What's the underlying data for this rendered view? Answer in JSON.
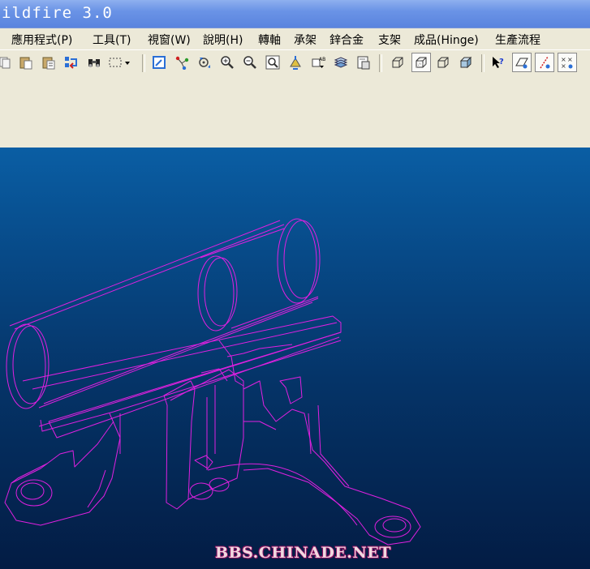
{
  "window": {
    "title": "ildfire 3.0"
  },
  "menu": {
    "items": [
      {
        "label": "應用程式(P)"
      },
      {
        "label": "工具(T)"
      },
      {
        "label": "視窗(W)"
      },
      {
        "label": "說明(H)"
      },
      {
        "label": "轉軸"
      },
      {
        "label": "承架"
      },
      {
        "label": "鋅合金"
      },
      {
        "label": "支架"
      },
      {
        "label": "成品(Hinge)"
      },
      {
        "label": "生產流程"
      }
    ]
  },
  "toolbar": {
    "buttons": [
      "copy-icon",
      "paste-icon",
      "paste-special-icon",
      "regenerate-icon",
      "find-icon",
      "select-box-icon",
      "repaint-icon",
      "spin-center-icon",
      "orient-mode-icon",
      "zoom-in-icon",
      "zoom-out-icon",
      "refit-icon",
      "reorient-icon",
      "saved-views-icon",
      "layers-icon",
      "model-setup-icon",
      "wireframe-icon",
      "hidden-line-icon",
      "no-hidden-icon",
      "shading-icon",
      "context-help-icon",
      "datum-planes-icon",
      "datum-axes-icon",
      "datum-points-icon"
    ],
    "pressed": "hidden-line-icon"
  },
  "viewport": {
    "background_top": "#0a5ea4",
    "background_bottom": "#031c44",
    "wireframe_color": "#e020e0",
    "watermark": "BBS.CHINADE.NET"
  }
}
